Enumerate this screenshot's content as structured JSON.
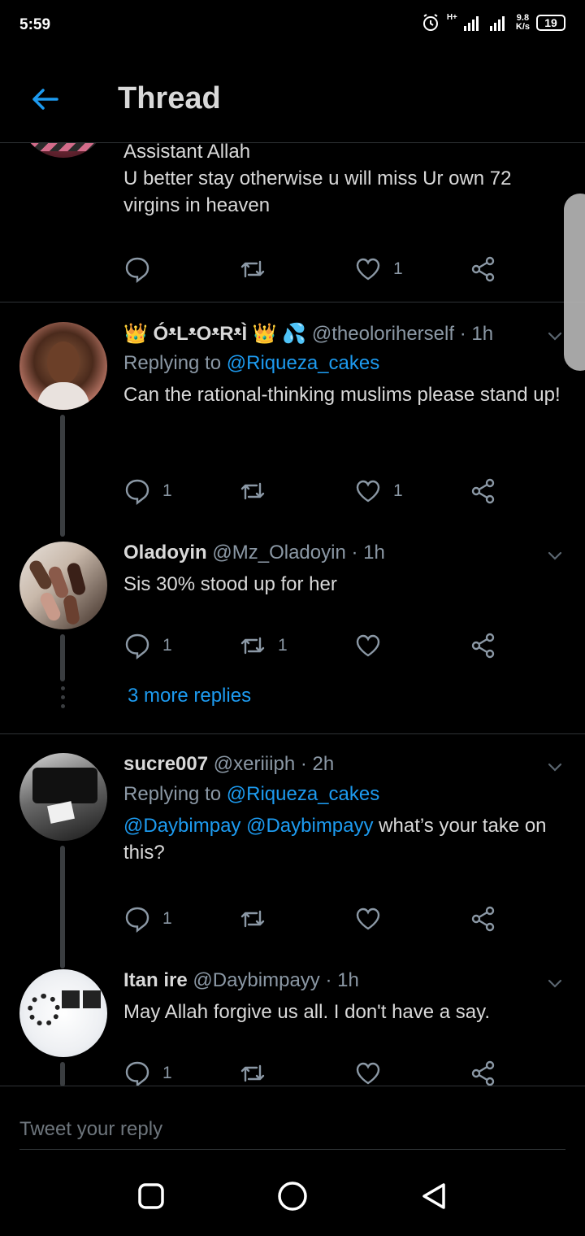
{
  "status_bar": {
    "time": "5:59",
    "net_speed_value": "9.8",
    "net_speed_unit": "K/s",
    "battery": "19",
    "network": "H+"
  },
  "header": {
    "title": "Thread"
  },
  "tweets": [
    {
      "author_lines": "Assistant Allah",
      "text": "U better stay otherwise u will miss Ur own 72 virgins in heaven",
      "reply_count": "",
      "retweet_count": "",
      "like_count": "1"
    },
    {
      "name": "👑 ÓᵜLᵜOᵜRᵜÌ 👑 💦",
      "handle": "@theoloriherself",
      "time": "· 1h",
      "replying_prefix": "Replying to ",
      "replying_to": "@Riqueza_cakes",
      "text": "Can the rational-thinking muslims please stand up!",
      "reply_count": "1",
      "retweet_count": "",
      "like_count": "1"
    },
    {
      "name": "Oladoyin",
      "handle": "@Mz_Oladoyin",
      "time": "· 1h",
      "text": "Sis 30% stood up for her",
      "reply_count": "1",
      "retweet_count": "1",
      "like_count": ""
    },
    {
      "name": "sucre007",
      "handle": "@xeriiiph",
      "time": "· 2h",
      "replying_prefix": "Replying to ",
      "replying_to": "@Riqueza_cakes",
      "mention1": "@Daybimpay",
      "mention2": "@Daybimpayy",
      "text": " what’s your take on this?",
      "reply_count": "1",
      "retweet_count": "",
      "like_count": ""
    },
    {
      "name": "Itan ire",
      "handle": "@Daybimpayy",
      "time": "· 1h",
      "text": "May Allah forgive us all. I don't have a say.",
      "reply_count": "1",
      "retweet_count": "",
      "like_count": ""
    }
  ],
  "more_replies": "3 more replies",
  "reply_box": {
    "placeholder": "Tweet your reply"
  },
  "colors": {
    "accent": "#1d9bf0",
    "background": "#000000",
    "muted": "#8b98a5",
    "divider": "#2f3336"
  },
  "icons": [
    "back-arrow-icon",
    "reply-icon",
    "retweet-icon",
    "like-icon",
    "share-icon",
    "chevron-down-icon",
    "alarm-icon",
    "signal-icon",
    "battery-icon",
    "recents-icon",
    "home-icon",
    "back-nav-icon"
  ]
}
